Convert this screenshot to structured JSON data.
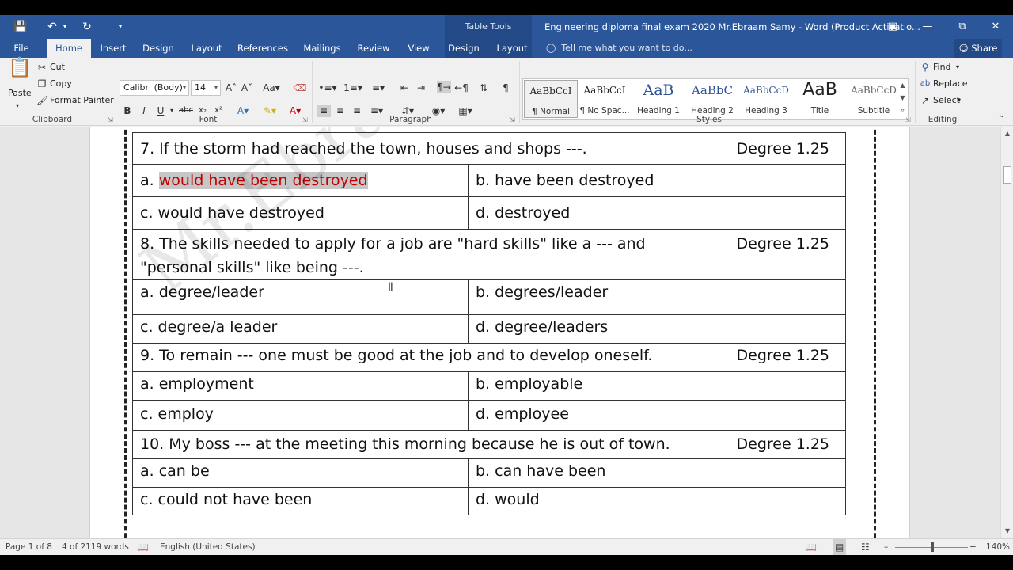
{
  "titlebar": {
    "context_tab": "Table Tools",
    "document_title": "Engineering diploma final exam 2020 Mr.Ebraam Samy - Word (Product Activatio..."
  },
  "tabs": {
    "file": "File",
    "home": "Home",
    "insert": "Insert",
    "design": "Design",
    "layout": "Layout",
    "references": "References",
    "mailings": "Mailings",
    "review": "Review",
    "view": "View",
    "table_design": "Design",
    "table_layout": "Layout",
    "tell_me": "Tell me what you want to do...",
    "share": "Share"
  },
  "clipboard": {
    "paste": "Paste",
    "cut": "Cut",
    "copy": "Copy",
    "format_painter": "Format Painter",
    "label": "Clipboard"
  },
  "font": {
    "name": "Calibri (Body)",
    "size": "14",
    "label": "Font"
  },
  "paragraph": {
    "label": "Paragraph"
  },
  "styles": {
    "label": "Styles",
    "items": [
      {
        "preview": "AaBbCcI",
        "name": "¶ Normal"
      },
      {
        "preview": "AaBbCcI",
        "name": "¶ No Spac..."
      },
      {
        "preview": "AaB",
        "name": "Heading 1"
      },
      {
        "preview": "AaBbC",
        "name": "Heading 2"
      },
      {
        "preview": "AaBbCcD",
        "name": "Heading 3"
      },
      {
        "preview": "AaB",
        "name": "Title"
      },
      {
        "preview": "AaBbCcD",
        "name": "Subtitle"
      }
    ]
  },
  "editing": {
    "find": "Find",
    "replace": "Replace",
    "select": "Select",
    "label": "Editing"
  },
  "document": {
    "watermark": "Mr.Ebraam S",
    "questions": [
      {
        "text": "7. If the storm had reached the town, houses and shops ---.",
        "degree": "Degree 1.25",
        "a_prefix": "a. ",
        "a_text": "would have been destroyed",
        "b": "b. have been destroyed",
        "c": "c. would have destroyed",
        "d": "d. destroyed"
      },
      {
        "text": "8. The skills needed to apply for a job are \"hard skills\" like a --- and \"personal skills\" like being ---.",
        "degree": "Degree 1.25",
        "a": "a. degree/leader",
        "b": "b. degrees/leader",
        "c": "c. degree/a leader",
        "d": "d. degree/leaders"
      },
      {
        "text": "9. To remain --- one must be good at the job and to develop oneself.",
        "degree": "Degree 1.25",
        "a": "a. employment",
        "b": "b. employable",
        "c": "c. employ",
        "d": "d. employee"
      },
      {
        "text": "10. My boss --- at the meeting this morning because he is out of town.",
        "degree": "Degree 1.25",
        "a": "a. can be",
        "b": "b. can have been",
        "c": "c. could not have been",
        "d": "d. would"
      }
    ]
  },
  "statusbar": {
    "page": "Page 1 of 8",
    "words": "4 of 2119 words",
    "language": "English (United States)",
    "zoom": "140%"
  }
}
